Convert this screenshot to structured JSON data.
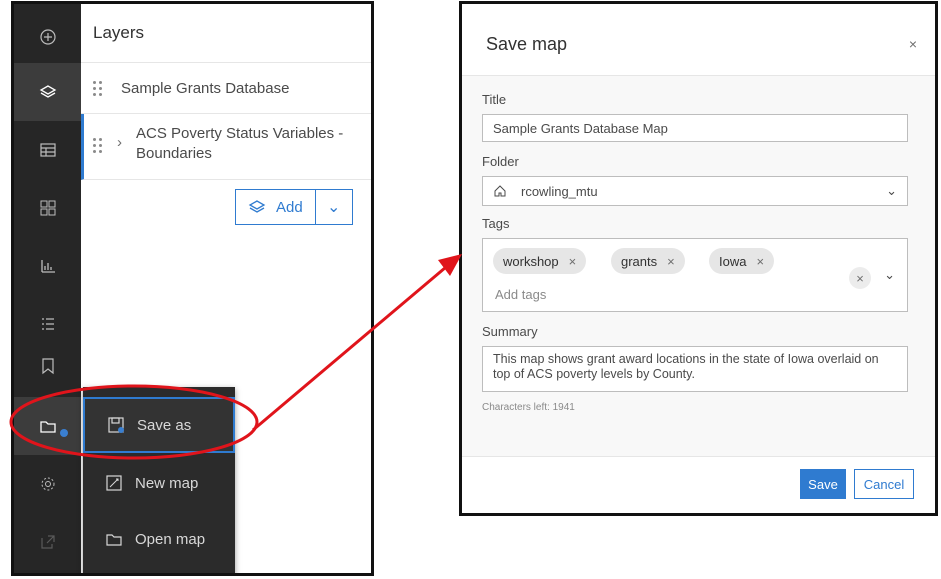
{
  "layers_panel": {
    "title": "Layers",
    "layers": [
      {
        "label": "Sample Grants Database"
      },
      {
        "label": "ACS Poverty Status Variables - Boundaries",
        "line1": "ACS Poverty Status Variables -",
        "line2": "Boundaries"
      }
    ],
    "add_label": "Add"
  },
  "rail_icons": [
    "plus-icon",
    "layers-icon",
    "table-icon",
    "basemap-icon",
    "chart-icon",
    "legend-icon",
    "bookmark-icon",
    "folder-icon",
    "settings-icon",
    "share-icon"
  ],
  "flyout": {
    "items": [
      {
        "label": "Save as",
        "icon": "save-icon"
      },
      {
        "label": "New map",
        "icon": "new-map-icon"
      },
      {
        "label": "Open map",
        "icon": "open-folder-icon"
      }
    ]
  },
  "dialog": {
    "title": "Save map",
    "close": "×",
    "title_label": "Title",
    "title_value": "Sample Grants Database Map",
    "folder_label": "Folder",
    "folder_value": "rcowling_mtu",
    "tags_label": "Tags",
    "tags": [
      "workshop",
      "grants",
      "Iowa"
    ],
    "tags_placeholder": "Add tags",
    "summary_label": "Summary",
    "summary_value": "This map shows grant award locations in the state of Iowa overlaid on top of ACS poverty levels by County.",
    "chars_left": "Characters left: 1941",
    "save_label": "Save",
    "cancel_label": "Cancel"
  },
  "colors": {
    "accent": "#2f7bd0",
    "annotation": "#e0141b",
    "rail": "#262626"
  }
}
